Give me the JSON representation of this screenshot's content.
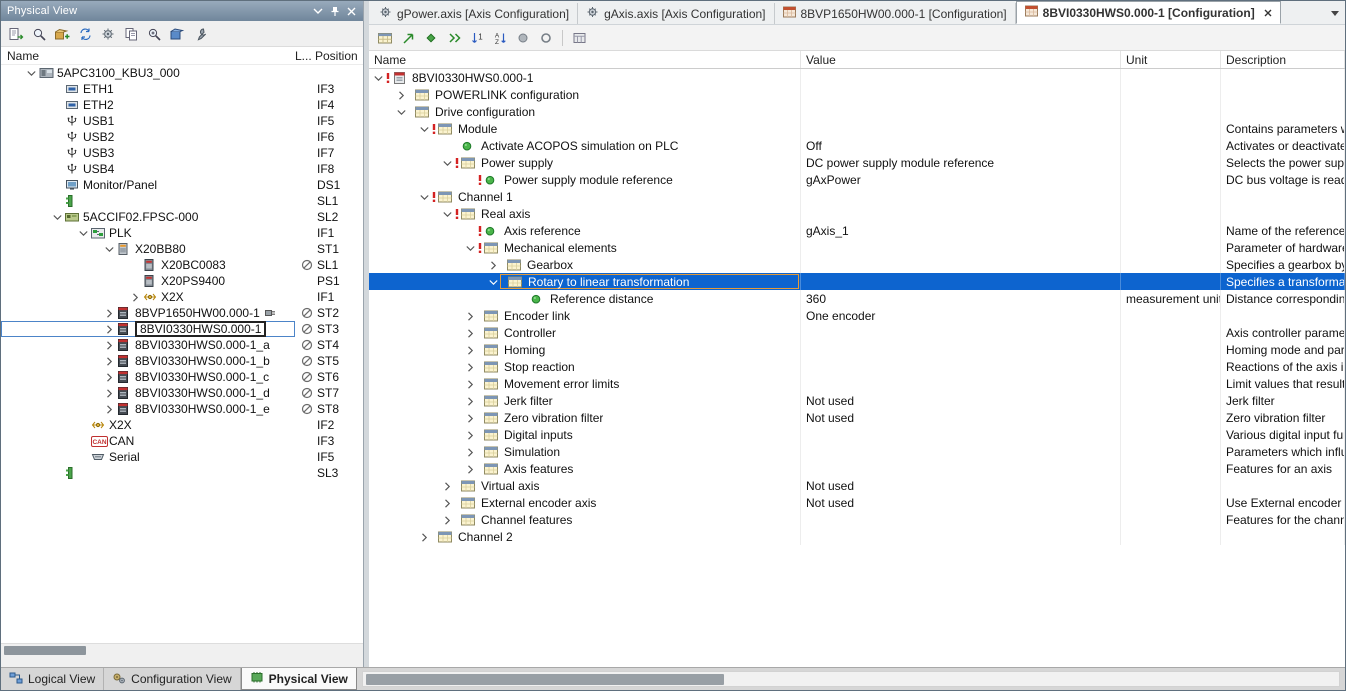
{
  "colors": {
    "selection_blue": "#0d64cf",
    "selection_focus_border": "#e39b3b",
    "panel_titlebar_top": "#98aabc",
    "panel_titlebar_bottom": "#70869b"
  },
  "left_panel": {
    "title": "Physical View",
    "titlebar_icons": [
      "window-menu-icon",
      "pin-icon",
      "close-icon"
    ],
    "toolbar_icons": [
      "export-icon",
      "search-hardware-icon",
      "add-hardware-icon",
      "replace-hardware-icon",
      "settings-icon",
      "copy-icon",
      "zoom-icon",
      "catalog-icon",
      "tools-icon"
    ],
    "columns": {
      "name": "Name",
      "l": "L...",
      "position": "Position"
    },
    "tree": [
      {
        "indent": 0,
        "expander": "down",
        "icon": "plc",
        "label": "5APC3100_KBU3_000",
        "position": ""
      },
      {
        "indent": 1,
        "expander": "none",
        "icon": "eth",
        "label": "ETH1",
        "position": "IF3"
      },
      {
        "indent": 1,
        "expander": "none",
        "icon": "eth",
        "label": "ETH2",
        "position": "IF4"
      },
      {
        "indent": 1,
        "expander": "none",
        "icon": "usb",
        "label": "USB1",
        "position": "IF5"
      },
      {
        "indent": 1,
        "expander": "none",
        "icon": "usb",
        "label": "USB2",
        "position": "IF6"
      },
      {
        "indent": 1,
        "expander": "none",
        "icon": "usb",
        "label": "USB3",
        "position": "IF7"
      },
      {
        "indent": 1,
        "expander": "none",
        "icon": "usb",
        "label": "USB4",
        "position": "IF8"
      },
      {
        "indent": 1,
        "expander": "none",
        "icon": "monitor",
        "label": "Monitor/Panel",
        "position": "DS1"
      },
      {
        "indent": 1,
        "expander": "none",
        "icon": "slot",
        "label": "",
        "position": "SL1"
      },
      {
        "indent": 1,
        "expander": "down",
        "icon": "card",
        "label": "5ACCIF02.FPSC-000",
        "position": "SL2"
      },
      {
        "indent": 2,
        "expander": "down",
        "icon": "plk",
        "label": "PLK",
        "position": "IF1"
      },
      {
        "indent": 3,
        "expander": "down",
        "icon": "module",
        "label": "X20BB80",
        "position": "ST1"
      },
      {
        "indent": 4,
        "expander": "none",
        "icon": "module2",
        "label": "X20BC0083",
        "position": "SL1",
        "no_symbol": true
      },
      {
        "indent": 4,
        "expander": "none",
        "icon": "module2",
        "label": "X20PS9400",
        "position": "PS1"
      },
      {
        "indent": 4,
        "expander": "right",
        "icon": "x2x",
        "label": "X2X",
        "position": "IF1"
      },
      {
        "indent": 3,
        "expander": "right",
        "icon": "drive",
        "label": "8BVP1650HW00.000-1",
        "position": "ST2",
        "no_symbol": true,
        "extra_icon": "connector"
      },
      {
        "indent": 3,
        "expander": "right",
        "icon": "drive",
        "label": "8BVI0330HWS0.000-1",
        "position": "ST3",
        "no_symbol": true,
        "selected": true
      },
      {
        "indent": 3,
        "expander": "right",
        "icon": "drive",
        "label": "8BVI0330HWS0.000-1_a",
        "position": "ST4",
        "no_symbol": true
      },
      {
        "indent": 3,
        "expander": "right",
        "icon": "drive",
        "label": "8BVI0330HWS0.000-1_b",
        "position": "ST5",
        "no_symbol": true
      },
      {
        "indent": 3,
        "expander": "right",
        "icon": "drive",
        "label": "8BVI0330HWS0.000-1_c",
        "position": "ST6",
        "no_symbol": true
      },
      {
        "indent": 3,
        "expander": "right",
        "icon": "drive",
        "label": "8BVI0330HWS0.000-1_d",
        "position": "ST7",
        "no_symbol": true
      },
      {
        "indent": 3,
        "expander": "right",
        "icon": "drive",
        "label": "8BVI0330HWS0.000-1_e",
        "position": "ST8",
        "no_symbol": true
      },
      {
        "indent": 2,
        "expander": "none",
        "icon": "x2x",
        "label": "X2X",
        "position": "IF2"
      },
      {
        "indent": 2,
        "expander": "none",
        "icon": "can",
        "label": "CAN",
        "position": "IF3"
      },
      {
        "indent": 2,
        "expander": "none",
        "icon": "serial",
        "label": "Serial",
        "position": "IF5"
      },
      {
        "indent": 1,
        "expander": "none",
        "icon": "slot",
        "label": "",
        "position": "SL3"
      }
    ]
  },
  "view_tabs": [
    {
      "label": "Logical View",
      "icon": "logical-view-icon",
      "active": false
    },
    {
      "label": "Configuration View",
      "icon": "configuration-view-icon",
      "active": false
    },
    {
      "label": "Physical View",
      "icon": "physical-view-icon",
      "active": true
    }
  ],
  "editor": {
    "tabs": [
      {
        "label": "gPower.axis [Axis Configuration]",
        "icon": "axis-file-icon",
        "active": false
      },
      {
        "label": "gAxis.axis [Axis Configuration]",
        "icon": "axis-file-icon",
        "active": false
      },
      {
        "label": "8BVP1650HW00.000-1 [Configuration]",
        "icon": "config-file-icon",
        "active": false
      },
      {
        "label": "8BVI0330HWS0.000-1 [Configuration]",
        "icon": "config-file-icon",
        "active": true,
        "close_label": "x"
      }
    ],
    "overflow_icon": "tab-list-dropdown-icon",
    "toolbar_icons": [
      "columns-icon",
      "open-parameter-icon",
      "compare-icon",
      "refresh-icon",
      "sort-number-icon",
      "sort-alpha-icon",
      "show-default-icon",
      "show-all-icon",
      "separator",
      "export-table-icon"
    ],
    "columns": {
      "name": "Name",
      "value": "Value",
      "unit": "Unit",
      "description": "Description"
    },
    "rows": [
      {
        "indent": 0,
        "expander": "down",
        "icon": "root",
        "mark": true,
        "name": "8BVI0330HWS0.000-1",
        "value": "",
        "unit": "",
        "description": ""
      },
      {
        "indent": 1,
        "expander": "right",
        "icon": "group",
        "mark": false,
        "name": "POWERLINK configuration",
        "value": "",
        "unit": "",
        "description": ""
      },
      {
        "indent": 1,
        "expander": "down",
        "icon": "group",
        "mark": false,
        "name": "Drive configuration",
        "value": "",
        "unit": "",
        "description": ""
      },
      {
        "indent": 2,
        "expander": "down",
        "icon": "group",
        "mark": true,
        "name": "Module",
        "value": "",
        "unit": "",
        "description": "Contains parameters wh..."
      },
      {
        "indent": 3,
        "expander": "none",
        "icon": "param",
        "mark": false,
        "name": "Activate ACOPOS simulation on PLC",
        "value": "Off",
        "unit": "",
        "description": "Activates or deactivates..."
      },
      {
        "indent": 3,
        "expander": "down",
        "icon": "group",
        "mark": true,
        "name": "Power supply",
        "value": "DC power supply module reference",
        "unit": "",
        "description": "Selects the power supp..."
      },
      {
        "indent": 4,
        "expander": "none",
        "icon": "param",
        "mark": true,
        "name": "Power supply module reference",
        "value": "gAxPower",
        "unit": "",
        "description": "DC bus voltage is read f..."
      },
      {
        "indent": 2,
        "expander": "down",
        "icon": "group",
        "mark": true,
        "name": "Channel 1",
        "value": "",
        "unit": "",
        "description": ""
      },
      {
        "indent": 3,
        "expander": "down",
        "icon": "group",
        "mark": true,
        "name": "Real axis",
        "value": "",
        "unit": "",
        "description": ""
      },
      {
        "indent": 4,
        "expander": "none",
        "icon": "param",
        "mark": true,
        "name": "Axis reference",
        "value": "gAxis_1",
        "unit": "",
        "description": "Name of the referenced..."
      },
      {
        "indent": 4,
        "expander": "down",
        "icon": "group",
        "mark": true,
        "name": "Mechanical elements",
        "value": "",
        "unit": "",
        "description": "Parameter of hardware ..."
      },
      {
        "indent": 5,
        "expander": "right",
        "icon": "group",
        "mark": false,
        "name": "Gearbox",
        "value": "",
        "unit": "",
        "description": "Specifies a gearbox by c..."
      },
      {
        "indent": 5,
        "expander": "down",
        "icon": "group",
        "mark": false,
        "name": "Rotary to linear transformation",
        "value": "",
        "unit": "",
        "description": "Specifies a transformatio...",
        "selected": true
      },
      {
        "indent": 6,
        "expander": "none",
        "icon": "param",
        "mark": false,
        "name": "Reference distance",
        "value": "360",
        "unit": "measurement unit...",
        "description": "Distance corresponding..."
      },
      {
        "indent": 4,
        "expander": "right",
        "icon": "group",
        "mark": false,
        "name": "Encoder link",
        "value": "One encoder",
        "unit": "",
        "description": ""
      },
      {
        "indent": 4,
        "expander": "right",
        "icon": "group",
        "mark": false,
        "name": "Controller",
        "value": "",
        "unit": "",
        "description": "Axis controller paramete..."
      },
      {
        "indent": 4,
        "expander": "right",
        "icon": "group",
        "mark": false,
        "name": "Homing",
        "value": "",
        "unit": "",
        "description": "Homing mode and para..."
      },
      {
        "indent": 4,
        "expander": "right",
        "icon": "group",
        "mark": false,
        "name": "Stop reaction",
        "value": "",
        "unit": "",
        "description": "Reactions of the axis in ..."
      },
      {
        "indent": 4,
        "expander": "right",
        "icon": "group",
        "mark": false,
        "name": "Movement error limits",
        "value": "",
        "unit": "",
        "description": "Limit values that result in..."
      },
      {
        "indent": 4,
        "expander": "right",
        "icon": "group",
        "mark": false,
        "name": "Jerk filter",
        "value": "Not used",
        "unit": "",
        "description": "Jerk filter"
      },
      {
        "indent": 4,
        "expander": "right",
        "icon": "group",
        "mark": false,
        "name": "Zero vibration filter",
        "value": "Not used",
        "unit": "",
        "description": "Zero vibration filter"
      },
      {
        "indent": 4,
        "expander": "right",
        "icon": "group",
        "mark": false,
        "name": "Digital inputs",
        "value": "",
        "unit": "",
        "description": "Various digital input func..."
      },
      {
        "indent": 4,
        "expander": "right",
        "icon": "group",
        "mark": false,
        "name": "Simulation",
        "value": "",
        "unit": "",
        "description": "Parameters which influe..."
      },
      {
        "indent": 4,
        "expander": "right",
        "icon": "group",
        "mark": false,
        "name": "Axis features",
        "value": "",
        "unit": "",
        "description": "Features for an axis"
      },
      {
        "indent": 3,
        "expander": "right",
        "icon": "group",
        "mark": false,
        "name": "Virtual axis",
        "value": "Not used",
        "unit": "",
        "description": ""
      },
      {
        "indent": 3,
        "expander": "right",
        "icon": "group",
        "mark": false,
        "name": "External encoder axis",
        "value": "Not used",
        "unit": "",
        "description": "Use External encoder a..."
      },
      {
        "indent": 3,
        "expander": "right",
        "icon": "group",
        "mark": false,
        "name": "Channel features",
        "value": "",
        "unit": "",
        "description": "Features for the channe..."
      },
      {
        "indent": 2,
        "expander": "right",
        "icon": "group",
        "mark": false,
        "name": "Channel 2",
        "value": "",
        "unit": "",
        "description": ""
      }
    ]
  }
}
